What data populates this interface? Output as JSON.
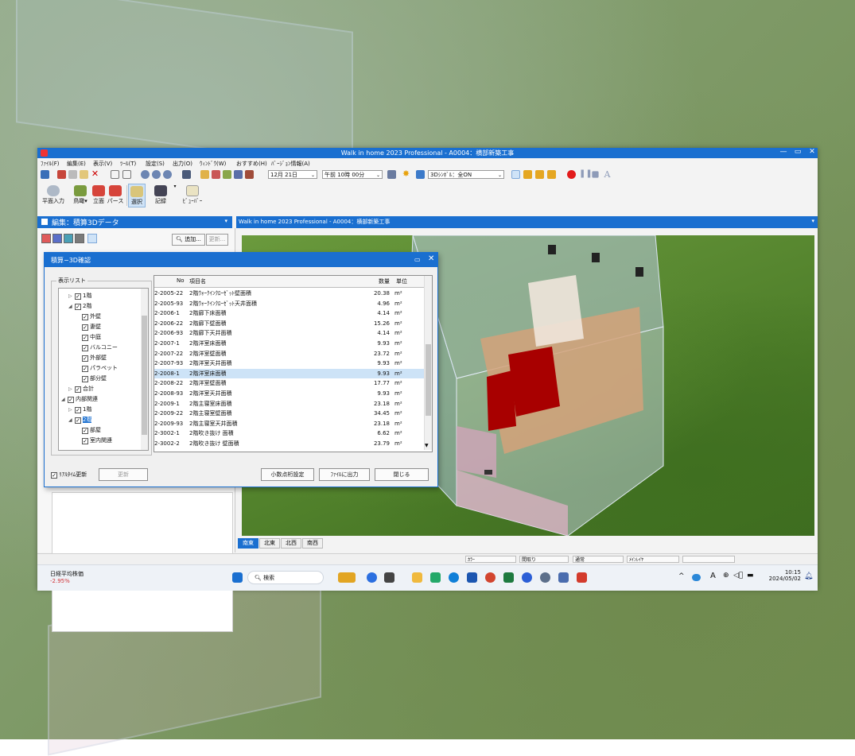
{
  "window": {
    "title": "Walk in home 2023 Professional - A0004：横部新築工事",
    "btn_min": "—",
    "btn_max": "▭",
    "btn_close": "✕"
  },
  "menu": [
    "ﾌｧｲﾙ(F)",
    "編集(E)",
    "表示(V)",
    "ﾂｰﾙ(T)",
    "設定(S)",
    "出力(O)",
    "ｳｨﾝﾄﾞｳ(W)",
    "おすすめ(H)",
    "ﾊﾞｰｼﾞｮﾝ情報(A)"
  ],
  "toolbar1": {
    "date": "12月 21日",
    "time": "午前 10時 00分",
    "symbol": "3Dｼﾝﾎﾞﾙ：全ON"
  },
  "toolbar2": {
    "plan_input": "平面入力",
    "birdseye": "鳥瞰",
    "elevation": "立面",
    "perspective": "パース",
    "select": "選択",
    "record": "記録",
    "viewer": "ﾋﾞｭｰﾊﾞｰ"
  },
  "left_panel": {
    "title": "編集：積算3Dデータ",
    "search_btn": "追加...",
    "update_btn": "更新..."
  },
  "viewport": {
    "title": "Walk in home 2023 Professional - A0004：横部新築工事",
    "tabs": [
      "南東",
      "北東",
      "北西",
      "南西"
    ]
  },
  "dialog": {
    "title": "積算−3D確認",
    "group_label": "表示リスト",
    "tree": [
      {
        "indent": 1,
        "expander": "▷",
        "checked": true,
        "label": "1階",
        "hl": false
      },
      {
        "indent": 1,
        "expander": "◢",
        "checked": true,
        "label": "2階",
        "hl": false
      },
      {
        "indent": 2,
        "expander": "",
        "checked": true,
        "label": "外壁",
        "hl": false
      },
      {
        "indent": 2,
        "expander": "",
        "checked": true,
        "label": "妻壁",
        "hl": false
      },
      {
        "indent": 2,
        "expander": "",
        "checked": true,
        "label": "中庭",
        "hl": false
      },
      {
        "indent": 2,
        "expander": "",
        "checked": true,
        "label": "バルコニー",
        "hl": false
      },
      {
        "indent": 2,
        "expander": "",
        "checked": true,
        "label": "外部壁",
        "hl": false
      },
      {
        "indent": 2,
        "expander": "",
        "checked": true,
        "label": "パラペット",
        "hl": false
      },
      {
        "indent": 2,
        "expander": "",
        "checked": true,
        "label": "部分壁",
        "hl": false
      },
      {
        "indent": 1,
        "expander": "▷",
        "checked": true,
        "label": "合計",
        "hl": false
      },
      {
        "indent": 0,
        "expander": "◢",
        "checked": true,
        "label": "内部関連",
        "hl": false
      },
      {
        "indent": 1,
        "expander": "▷",
        "checked": true,
        "label": "1階",
        "hl": false
      },
      {
        "indent": 1,
        "expander": "◢",
        "checked": true,
        "label": "2階",
        "hl": true
      },
      {
        "indent": 2,
        "expander": "",
        "checked": true,
        "label": "部屋",
        "hl": false
      },
      {
        "indent": 2,
        "expander": "",
        "checked": true,
        "label": "室内関連",
        "hl": false
      }
    ],
    "columns": {
      "no": "No",
      "name": "項目名",
      "qty": "数量",
      "unit": "単位"
    },
    "rows": [
      {
        "no": "2-2005-22",
        "name": "2階ｳｫｰｸｲﾝｸﾛｰｾﾞｯﾄ壁面積",
        "qty": "20.38",
        "unit": "m²",
        "sel": false
      },
      {
        "no": "2-2005-93",
        "name": "2階ｳｫｰｸｲﾝｸﾛｰｾﾞｯﾄ天井面積",
        "qty": "4.96",
        "unit": "m²",
        "sel": false
      },
      {
        "no": "2-2006-1",
        "name": "2階廊下床面積",
        "qty": "4.14",
        "unit": "m²",
        "sel": false
      },
      {
        "no": "2-2006-22",
        "name": "2階廊下壁面積",
        "qty": "15.26",
        "unit": "m²",
        "sel": false
      },
      {
        "no": "2-2006-93",
        "name": "2階廊下天井面積",
        "qty": "4.14",
        "unit": "m²",
        "sel": false
      },
      {
        "no": "2-2007-1",
        "name": "2階洋室床面積",
        "qty": "9.93",
        "unit": "m²",
        "sel": false
      },
      {
        "no": "2-2007-22",
        "name": "2階洋室壁面積",
        "qty": "23.72",
        "unit": "m²",
        "sel": false
      },
      {
        "no": "2-2007-93",
        "name": "2階洋室天井面積",
        "qty": "9.93",
        "unit": "m²",
        "sel": false
      },
      {
        "no": "2-2008-1",
        "name": "2階洋室床面積",
        "qty": "9.93",
        "unit": "m²",
        "sel": true
      },
      {
        "no": "2-2008-22",
        "name": "2階洋室壁面積",
        "qty": "17.77",
        "unit": "m²",
        "sel": false
      },
      {
        "no": "2-2008-93",
        "name": "2階洋室天井面積",
        "qty": "9.93",
        "unit": "m²",
        "sel": false
      },
      {
        "no": "2-2009-1",
        "name": "2階主寝室床面積",
        "qty": "23.18",
        "unit": "m²",
        "sel": false
      },
      {
        "no": "2-2009-22",
        "name": "2階主寝室壁面積",
        "qty": "34.45",
        "unit": "m²",
        "sel": false
      },
      {
        "no": "2-2009-93",
        "name": "2階主寝室天井面積",
        "qty": "23.18",
        "unit": "m²",
        "sel": false
      },
      {
        "no": "2-3002-1",
        "name": "2階吹き抜け 面積",
        "qty": "6.62",
        "unit": "m²",
        "sel": false
      },
      {
        "no": "2-3002-2",
        "name": "2階吹き抜け 壁面積",
        "qty": "23.79",
        "unit": "m²",
        "sel": false
      }
    ],
    "realtime_label": "ﾘｱﾙﾀｲﾑ更新",
    "update_btn": "更新",
    "decimal_btn": "小数点桁設定",
    "export_btn": "ﾌｧｲﾙに出力",
    "close_btn": "閉じる"
  },
  "statusbar": [
    "ｶﾗｰ",
    "間取り",
    "通常",
    "ﾒｲﾝﾚｲﾔ"
  ],
  "taskbar": {
    "stock_label": "日経平均株価",
    "stock_value": "-2.95%",
    "search_placeholder": "検索",
    "ime": "A",
    "time": "10:15",
    "date": "2024/05/02"
  },
  "colors": {
    "accent": "#1a6fd0",
    "stock_down": "#d13438"
  }
}
